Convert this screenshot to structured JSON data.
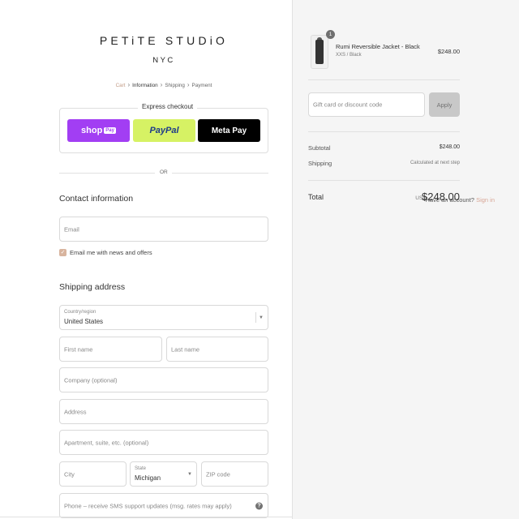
{
  "brand": {
    "name": "PETiTE STUDiO",
    "location": "NYC"
  },
  "breadcrumbs": [
    "Cart",
    "Information",
    "Shipping",
    "Payment"
  ],
  "express": {
    "title": "Express checkout",
    "shop_pay": "shop",
    "shop_pay_tag": "Pay",
    "paypal": "PayPal",
    "metapay": "Meta Pay",
    "or": "OR"
  },
  "contact": {
    "title": "Contact information",
    "account_prompt": "Have an account?",
    "sign_in": "Sign in",
    "email_placeholder": "Email",
    "newsletter_label": "Email me with news and offers",
    "newsletter_checked": true
  },
  "shipping": {
    "title": "Shipping address",
    "country_label": "Country/region",
    "country_value": "United States",
    "first_name": "First name",
    "last_name": "Last name",
    "company": "Company (optional)",
    "address": "Address",
    "apartment": "Apartment, suite, etc. (optional)",
    "city": "City",
    "state_label": "State",
    "state_value": "Michigan",
    "zip": "ZIP code",
    "phone": "Phone – receive SMS support updates (msg. rates may apply)"
  },
  "cart": {
    "item": {
      "quantity": "1",
      "name": "Rumi Reversible Jacket - Black",
      "variant": "XXS / Black",
      "price": "$248.00"
    },
    "discount_placeholder": "Gift card or discount code",
    "apply_label": "Apply",
    "subtotal_label": "Subtotal",
    "subtotal_value": "$248.00",
    "shipping_label": "Shipping",
    "shipping_value": "Calculated at next step",
    "total_label": "Total",
    "currency": "USD",
    "total_value": "$248.00"
  }
}
